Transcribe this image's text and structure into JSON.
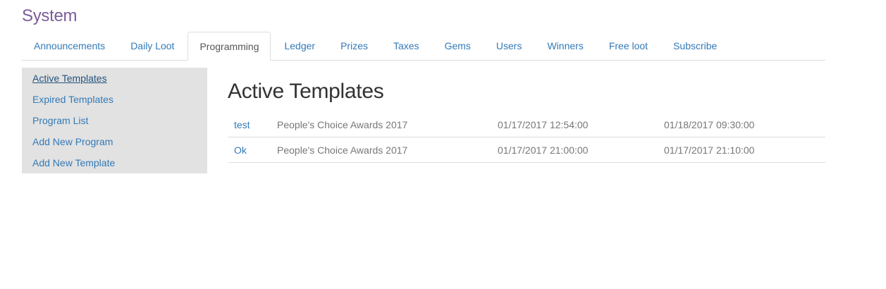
{
  "app": {
    "title": "System"
  },
  "tabs": [
    {
      "label": "Announcements",
      "active": false
    },
    {
      "label": "Daily Loot",
      "active": false
    },
    {
      "label": "Programming",
      "active": true
    },
    {
      "label": "Ledger",
      "active": false
    },
    {
      "label": "Prizes",
      "active": false
    },
    {
      "label": "Taxes",
      "active": false
    },
    {
      "label": "Gems",
      "active": false
    },
    {
      "label": "Users",
      "active": false
    },
    {
      "label": "Winners",
      "active": false
    },
    {
      "label": "Free loot",
      "active": false
    },
    {
      "label": "Subscribe",
      "active": false
    }
  ],
  "sidebar": {
    "items": [
      {
        "label": "Active Templates",
        "active": true
      },
      {
        "label": "Expired Templates",
        "active": false
      },
      {
        "label": "Program List",
        "active": false
      },
      {
        "label": "Add New Program",
        "active": false
      },
      {
        "label": "Add New Template",
        "active": false
      }
    ]
  },
  "main": {
    "title": "Active Templates",
    "rows": [
      {
        "name": "test",
        "event": "People's Choice Awards 2017",
        "start": "01/17/2017 12:54:00",
        "end": "01/18/2017 09:30:00"
      },
      {
        "name": "Ok",
        "event": "People's Choice Awards 2017",
        "start": "01/17/2017 21:00:00",
        "end": "01/17/2017 21:10:00"
      }
    ]
  },
  "colors": {
    "title": "#7b5c9c",
    "link": "#337ab7",
    "sidebar_bg": "#e2e2e2",
    "border": "#dddddd"
  }
}
